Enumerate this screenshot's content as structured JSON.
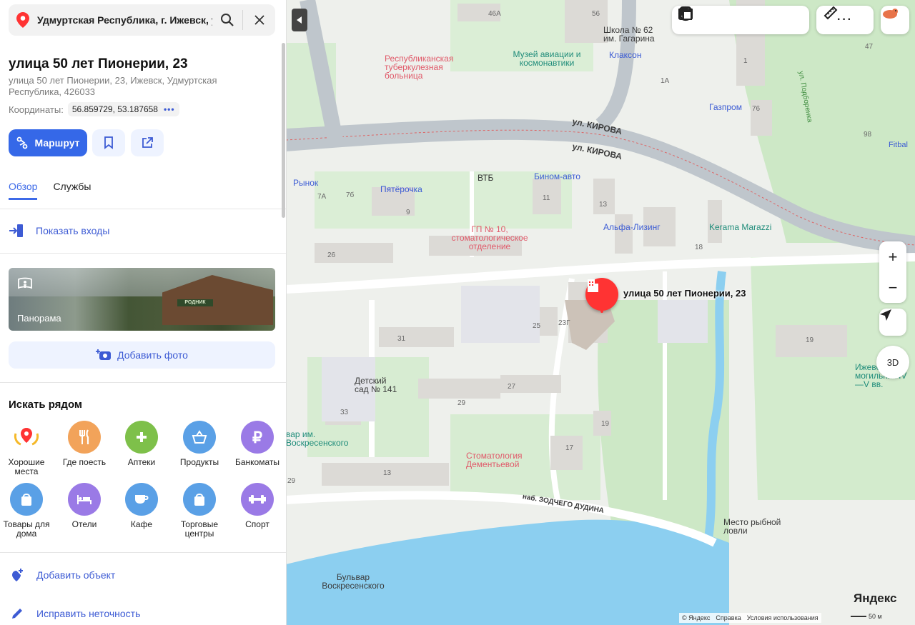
{
  "search": {
    "query": "Удмуртская Республика, г. Ижевск, у"
  },
  "place": {
    "title": "улица 50 лет Пионерии, 23",
    "address": "улица 50 лет Пионерии, 23, Ижевск, Удмуртская Республика, 426033",
    "coords_label": "Координаты:",
    "coords_value": "56.859729, 53.187658",
    "coords_more": "•••"
  },
  "actions": {
    "route": "Маршрут"
  },
  "tabs": [
    {
      "label": "Обзор",
      "active": true
    },
    {
      "label": "Службы",
      "active": false
    }
  ],
  "entrances": "Показать входы",
  "panorama": {
    "label": "Панорама",
    "sign": "РОДНИК"
  },
  "add_photo": "Добавить фото",
  "nearby": {
    "title": "Искать рядом",
    "items": [
      {
        "label": "Хорошие места",
        "color": "#ffffff",
        "icon": "medal-icon"
      },
      {
        "label": "Где поесть",
        "color": "#f2a35a",
        "icon": "fork-knife-icon"
      },
      {
        "label": "Аптеки",
        "color": "#7ec04a",
        "icon": "plus-icon"
      },
      {
        "label": "Продукты",
        "color": "#5aa0e6",
        "icon": "basket-icon"
      },
      {
        "label": "Банкоматы",
        "color": "#9a7ae6",
        "icon": "ruble-icon"
      },
      {
        "label": "Товары для дома",
        "color": "#5aa0e6",
        "icon": "bag-icon"
      },
      {
        "label": "Отели",
        "color": "#9a7ae6",
        "icon": "bed-icon"
      },
      {
        "label": "Кафе",
        "color": "#5aa0e6",
        "icon": "cup-icon"
      },
      {
        "label": "Торговые центры",
        "color": "#5aa0e6",
        "icon": "bag-icon"
      },
      {
        "label": "Спорт",
        "color": "#9a7ae6",
        "icon": "dumbbell-icon"
      }
    ]
  },
  "add_object": "Добавить объект",
  "fix": "Исправить неточность",
  "map": {
    "marker_label": "улица 50 лет Пионерии, 23",
    "labels": [
      "ул. КИРОВА",
      "ул. КИРОВА",
      "Республиканская туберкулезная больница",
      "Музей авиации и космонавтики",
      "Школа № 62 им. Гагарина",
      "Клаксон",
      "Газпром",
      "ВТБ",
      "Бином-авто",
      "Пятёрочка",
      "Рынок",
      "ГП № 10, стоматологическое отделение",
      "Альфа-Лизинг",
      "Kerama Marazzi",
      "Детский сад № 141",
      "Стоматология Дементьевой",
      "наб. ЗОДЧЕГО ДУДИНА",
      "Место рыбной ловли",
      "Бульвар Воскресенского",
      "ул. Подборенка",
      "Fitbal",
      "Ижевский могильник IV—V вв.",
      "вар им. Воскресенского"
    ],
    "numbers": [
      "46А",
      "56",
      "1",
      "1А",
      "47",
      "76",
      "98",
      "11",
      "13",
      "9",
      "7А",
      "7б",
      "26",
      "18",
      "25",
      "23Г",
      "31",
      "27",
      "29",
      "33",
      "19",
      "17",
      "13",
      "29",
      "19"
    ],
    "footer": {
      "copyright": "© Яндекс",
      "help": "Справка",
      "terms": "Условия использования",
      "scale": "50 м",
      "logo": "Яндекс"
    },
    "controls": {
      "zoom_in": "+",
      "zoom_out": "−",
      "three_d": "3D"
    }
  }
}
